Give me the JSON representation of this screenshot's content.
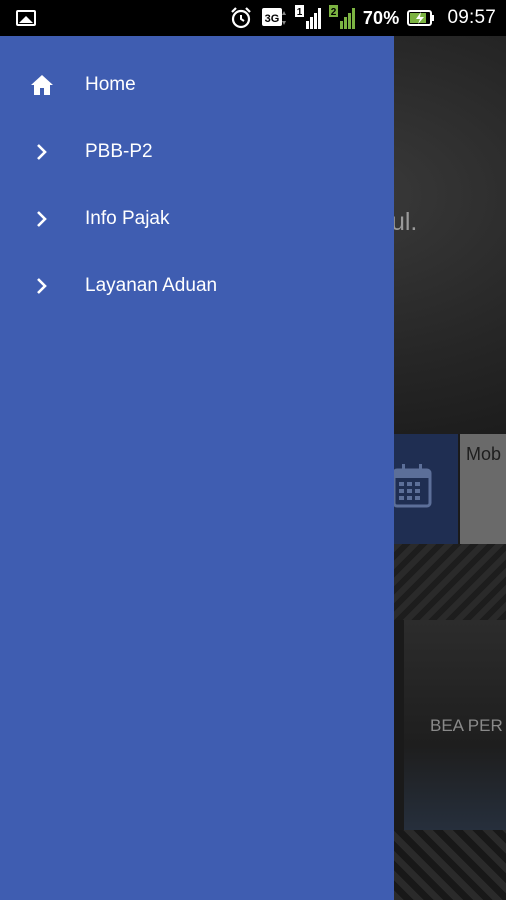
{
  "status_bar": {
    "battery_percent": "70%",
    "time": "09:57",
    "network_type": "3G",
    "sim_slot_1": "1",
    "sim_slot_2": "2",
    "icons": [
      "gallery-icon",
      "alarm-icon",
      "3g-icon",
      "signal-sim1-icon",
      "signal-sim2-icon",
      "battery-charging-icon"
    ]
  },
  "drawer": {
    "background_color": "#3f5db1",
    "items": [
      {
        "label": "Home",
        "icon": "home-icon"
      },
      {
        "label": "PBB-P2",
        "icon": "chevron-right-icon"
      },
      {
        "label": "Info Pajak",
        "icon": "chevron-right-icon"
      },
      {
        "label": "Layanan Aduan",
        "icon": "chevron-right-icon"
      }
    ]
  },
  "background": {
    "hero_text": "tul.",
    "tile_text": "Mob",
    "card_text": "BEA PER"
  }
}
